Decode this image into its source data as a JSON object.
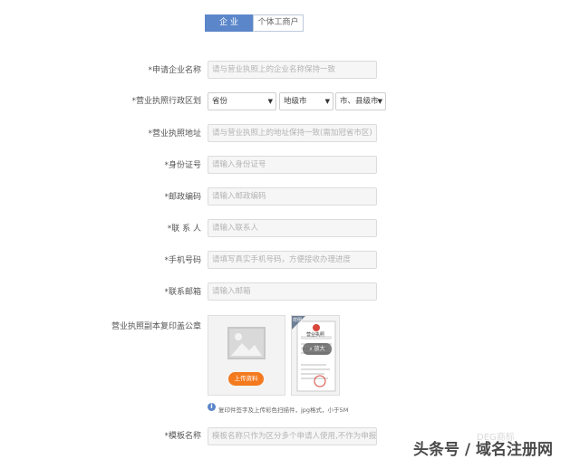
{
  "tabs": {
    "enterprise": "企 业",
    "individual": "个体工商户"
  },
  "fields": {
    "company_name": {
      "label": "*申请企业名称",
      "placeholder": "请与营业执照上的企业名称保持一致"
    },
    "region": {
      "label": "*营业执照行政区划",
      "province": "省份",
      "city": "地级市",
      "county": "市、县级市"
    },
    "address": {
      "label": "*营业执照地址",
      "placeholder": "请与营业执照上的地址保持一致(需加冠省市区)"
    },
    "id_number": {
      "label": "*身份证号",
      "placeholder": "请输入身份证号"
    },
    "postal_code": {
      "label": "*邮政编码",
      "placeholder": "请输入邮政编码"
    },
    "contact": {
      "label": "*联 系 人",
      "placeholder": "请输入联系人"
    },
    "phone": {
      "label": "*手机号码",
      "placeholder": "请填写真实手机号码，方便接收办理进度"
    },
    "email": {
      "label": "*联系邮箱",
      "placeholder": "请输入邮箱"
    },
    "license_copy": {
      "label": "营业执照副本复印盖公章",
      "upload_button": "上传资料",
      "sample_badge": "样例",
      "sample_title": "营业执照",
      "zoom": "放大"
    },
    "template": {
      "label": "*模板名称",
      "placeholder": "模板名称只作为区分多个申请人使用,不作为申报前"
    }
  },
  "hint": "复印件签字及上传彩色扫描件，jpg格式，小于5M",
  "watermark": {
    "faded": "DEG商标",
    "main": "头条号 / 域名注册网"
  }
}
